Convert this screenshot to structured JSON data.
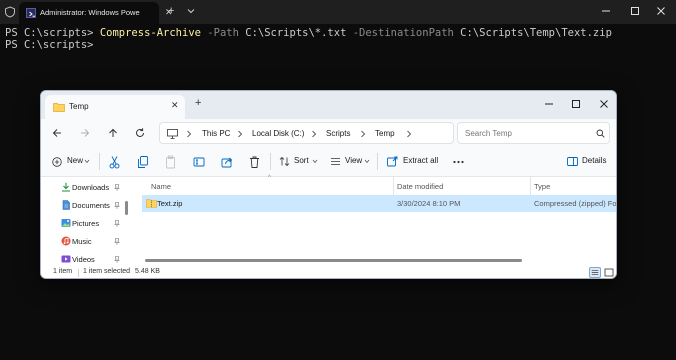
{
  "terminal": {
    "tab_title": "Administrator: Windows PowerShell",
    "lines": [
      {
        "prompt": "PS C:\\scripts> ",
        "command": "Compress-Archive",
        "rest": [
          {
            "text": " -Path",
            "kind": "param"
          },
          {
            "text": " C:\\Scripts\\*.txt",
            "kind": "arg"
          },
          {
            "text": " -DestinationPath",
            "kind": "param"
          },
          {
            "text": " C:\\Scripts\\Temp\\Text.zip",
            "kind": "arg"
          }
        ]
      },
      {
        "prompt": "PS C:\\scripts> "
      }
    ]
  },
  "explorer": {
    "tab_title": "Temp",
    "breadcrumb": [
      "This PC",
      "Local Disk (C:)",
      "Scripts",
      "Temp"
    ],
    "search_placeholder": "Search Temp",
    "toolbar": {
      "new_label": "New",
      "sort_label": "Sort",
      "view_label": "View",
      "extract_label": "Extract all",
      "details_label": "Details"
    },
    "nav_items": [
      {
        "label": "Downloads",
        "icon": "download-icon"
      },
      {
        "label": "Documents",
        "icon": "document-icon"
      },
      {
        "label": "Pictures",
        "icon": "pictures-icon"
      },
      {
        "label": "Music",
        "icon": "music-icon"
      },
      {
        "label": "Videos",
        "icon": "videos-icon"
      }
    ],
    "columns": {
      "name": "Name",
      "date": "Date modified",
      "type": "Type"
    },
    "files": [
      {
        "name": "Text.zip",
        "date": "3/30/2024 8:10 PM",
        "type": "Compressed (zipped) Folder"
      }
    ],
    "status": {
      "count": "1 item",
      "selected": "1 item selected",
      "size": "5.48 KB"
    }
  },
  "colors": {
    "accent": "#0067c0",
    "selection": "#cce8ff",
    "terminal_bg": "#0c0c0c",
    "cmdlet": "#f9f1a5"
  }
}
